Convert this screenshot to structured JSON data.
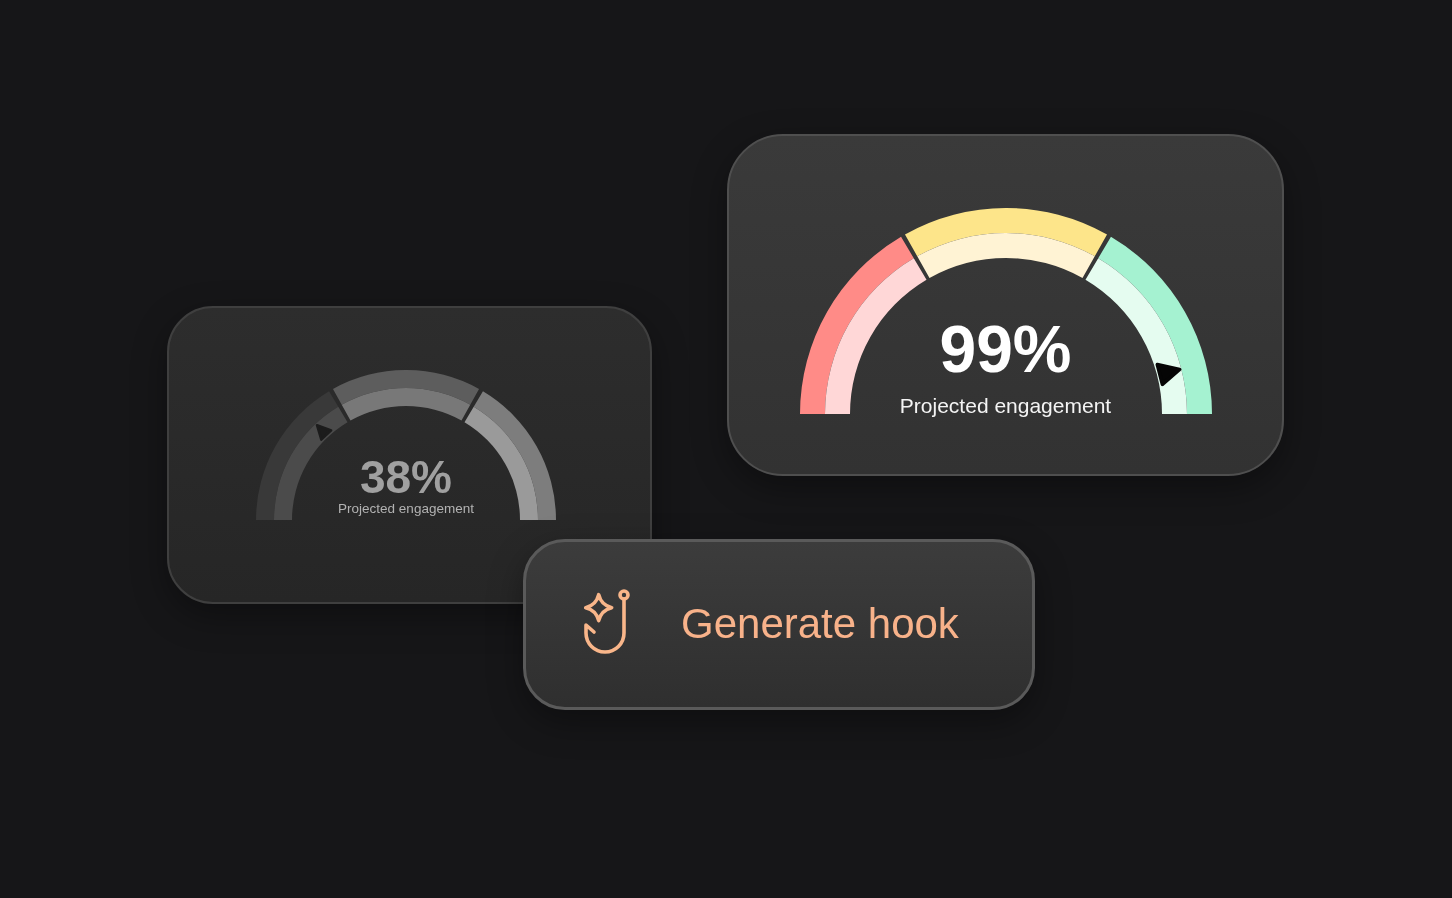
{
  "gauges": [
    {
      "kind": "muted",
      "value": "38%",
      "label": "Projected engagement",
      "level": 0.26
    },
    {
      "kind": "vivid",
      "value": "99%",
      "label": "Projected engagement",
      "level": 0.92
    }
  ],
  "action_button": {
    "label": "Generate hook"
  }
}
